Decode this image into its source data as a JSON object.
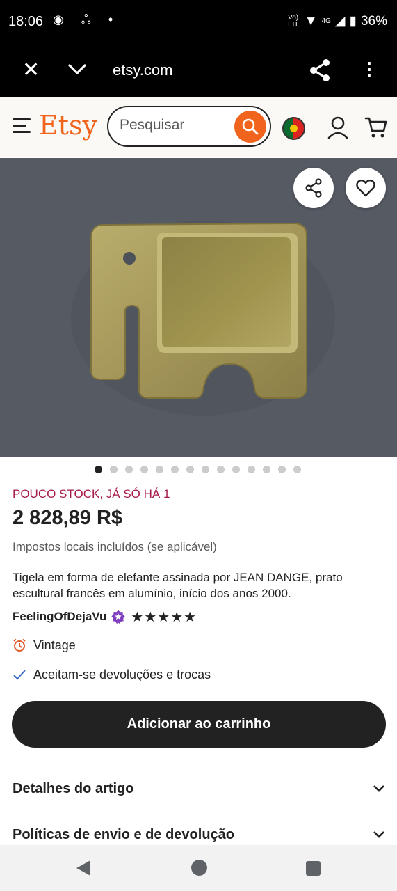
{
  "status_bar": {
    "time": "18:06",
    "battery": "36%",
    "network": "4G",
    "volte": "Vo) LTE"
  },
  "browser": {
    "url": "etsy.com"
  },
  "header": {
    "logo": "Etsy",
    "search_placeholder": "Pesquisar",
    "brand_color": "#f1641e"
  },
  "gallery": {
    "total_images": 14,
    "active_index": 0
  },
  "product": {
    "stock_notice": "POUCO STOCK, JÁ SÓ HÁ 1",
    "price": "2 828,89 R$",
    "taxes": "Impostos locais incluídos (se aplicável)",
    "title": "Tigela em forma de elefante assinada por JEAN DANGE, prato escultural francês em alumínio, início dos anos 2000.",
    "seller": "FeelingOfDejaVu",
    "rating": 5,
    "stars": "★★★★★",
    "features": {
      "vintage": "Vintage",
      "returns": "Aceitam-se devoluções e trocas"
    },
    "add_to_cart": "Adicionar ao carrinho"
  },
  "sections": {
    "details": "Detalhes do artigo",
    "policies": "Políticas de envio e de devolução"
  }
}
